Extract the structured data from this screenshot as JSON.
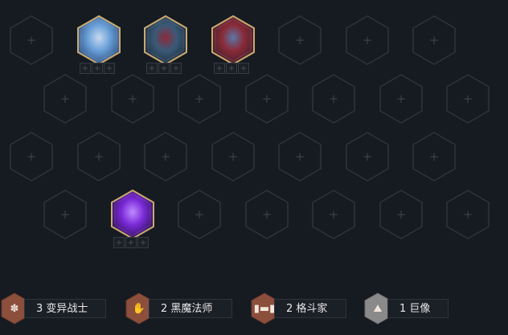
{
  "board": {
    "empty_symbol": "+",
    "champions": [
      {
        "portrait_icon": "champion-blue-skinned-warrior-portrait",
        "item_slots": [
          "+",
          "+",
          "+"
        ]
      },
      {
        "portrait_icon": "champion-dark-armored-beast-portrait",
        "item_slots": [
          "+",
          "+",
          "+"
        ]
      },
      {
        "portrait_icon": "champion-red-spiked-creature-portrait",
        "item_slots": [
          "+",
          "+",
          "+"
        ]
      },
      {
        "portrait_icon": "champion-purple-crystal-portrait",
        "item_slots": [
          "+",
          "+",
          "+"
        ]
      }
    ]
  },
  "traits": [
    {
      "count": "3",
      "name": "变异战士",
      "icon": "mutant-trait-icon",
      "color": "#8b4f3c"
    },
    {
      "count": "2",
      "name": "黑魔法师",
      "icon": "hand-trait-icon",
      "color": "#8b4f3c"
    },
    {
      "count": "2",
      "name": "格斗家",
      "icon": "dumbbell-trait-icon",
      "color": "#8b4f3c"
    },
    {
      "count": "1",
      "name": "巨像",
      "icon": "colossus-trait-icon",
      "color": "#8a8a8a"
    }
  ],
  "colors": {
    "background": "#161a21",
    "empty_hex_stroke": "#2f343c",
    "champion_border": "#c8aa6e",
    "trait_bronze": "#8b4f3c",
    "trait_silver": "#8a8a8a"
  }
}
